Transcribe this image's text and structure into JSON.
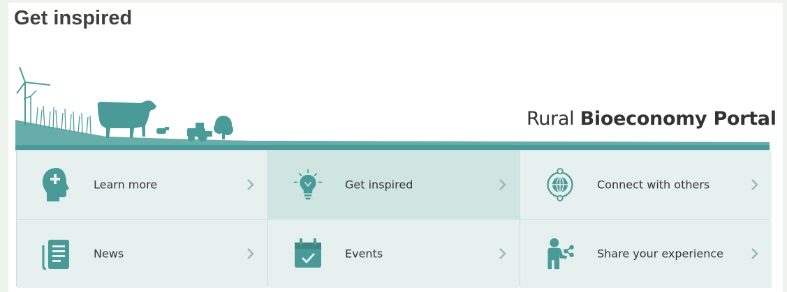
{
  "page": {
    "title": "Get inspired"
  },
  "banner": {
    "portal_light": "Rural ",
    "portal_bold": "Bioeconomy Portal",
    "accent_color": "#4a9b97"
  },
  "tiles": [
    {
      "label": "Learn more",
      "icon": "head-plus-icon"
    },
    {
      "label": "Get inspired",
      "icon": "lightbulb-icon",
      "active": true
    },
    {
      "label": "Connect with others",
      "icon": "globe-network-icon"
    },
    {
      "label": "News",
      "icon": "newspaper-icon"
    },
    {
      "label": "Events",
      "icon": "calendar-check-icon"
    },
    {
      "label": "Share your experience",
      "icon": "person-share-icon"
    }
  ]
}
